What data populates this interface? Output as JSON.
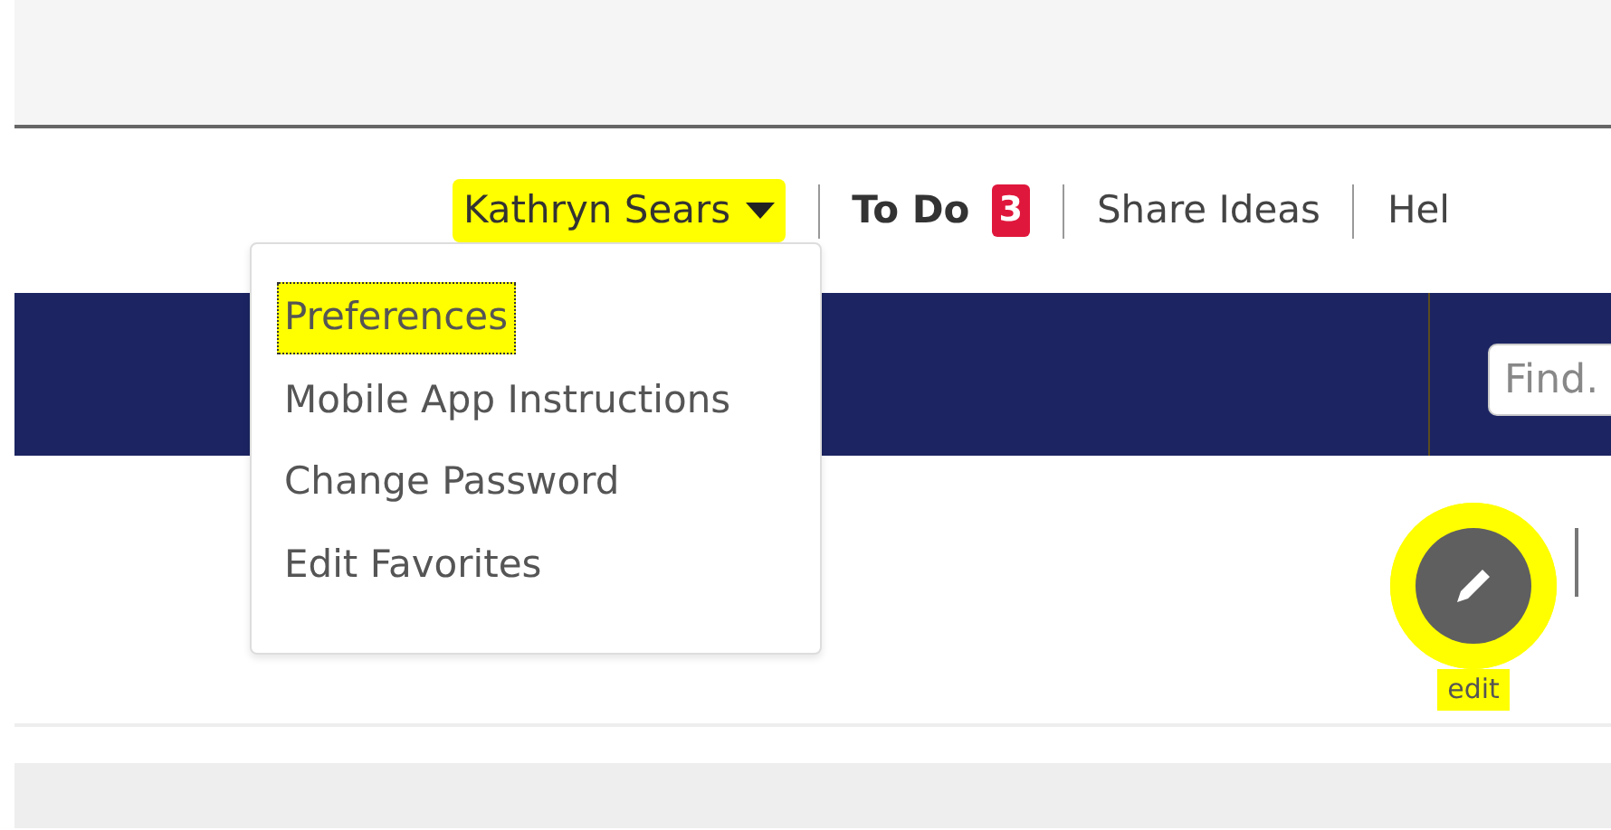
{
  "user_menu": {
    "label": "Kathryn Sears",
    "highlighted": true,
    "expanded": true,
    "items": [
      {
        "label": "Preferences",
        "highlighted": true,
        "focused": true
      },
      {
        "label": "Mobile App Instructions",
        "highlighted": false,
        "focused": false
      },
      {
        "label": "Change Password",
        "highlighted": false,
        "focused": false
      },
      {
        "label": "Edit Favorites",
        "highlighted": false,
        "focused": false
      }
    ]
  },
  "todo": {
    "label": "To Do",
    "count": "3"
  },
  "links": [
    "Share Ideas",
    "Hel"
  ],
  "search": {
    "placeholder": "Find."
  },
  "edit_button": {
    "label": "edit",
    "highlighted": true
  }
}
